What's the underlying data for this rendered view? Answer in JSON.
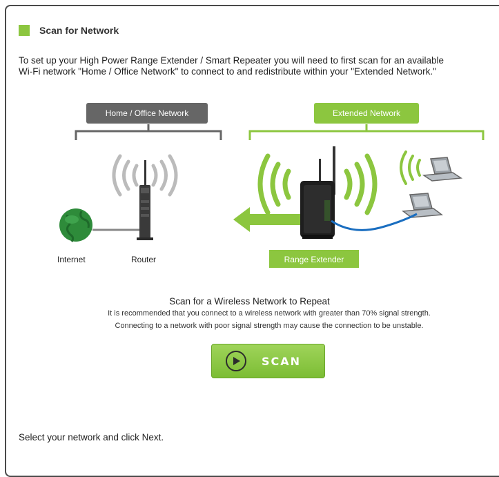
{
  "section": {
    "title": "Scan for Network"
  },
  "intro": {
    "line1": "To set up your High Power Range Extender / Smart Repeater you will need to first scan for an available",
    "line2": "Wi-Fi network \"Home / Office Network\" to connect to and redistribute within your \"Extended Network.\""
  },
  "diagram": {
    "home_label": "Home / Office Network",
    "extended_label": "Extended Network",
    "internet_label": "Internet",
    "router_label": "Router",
    "extender_label": "Range Extender",
    "colors": {
      "green": "#8cc63f",
      "dark_gray": "#666666"
    }
  },
  "scan": {
    "heading": "Scan for a Wireless Network to Repeat",
    "note_line1": "It is recommended that you connect to a wireless network with greater than 70% signal strength.",
    "note_line2": "Connecting to a network with poor signal strength may cause the connection to be unstable.",
    "button_label": "SCAN",
    "button_icon": "play-icon"
  },
  "footer": {
    "instruction": "Select your network and click Next."
  }
}
